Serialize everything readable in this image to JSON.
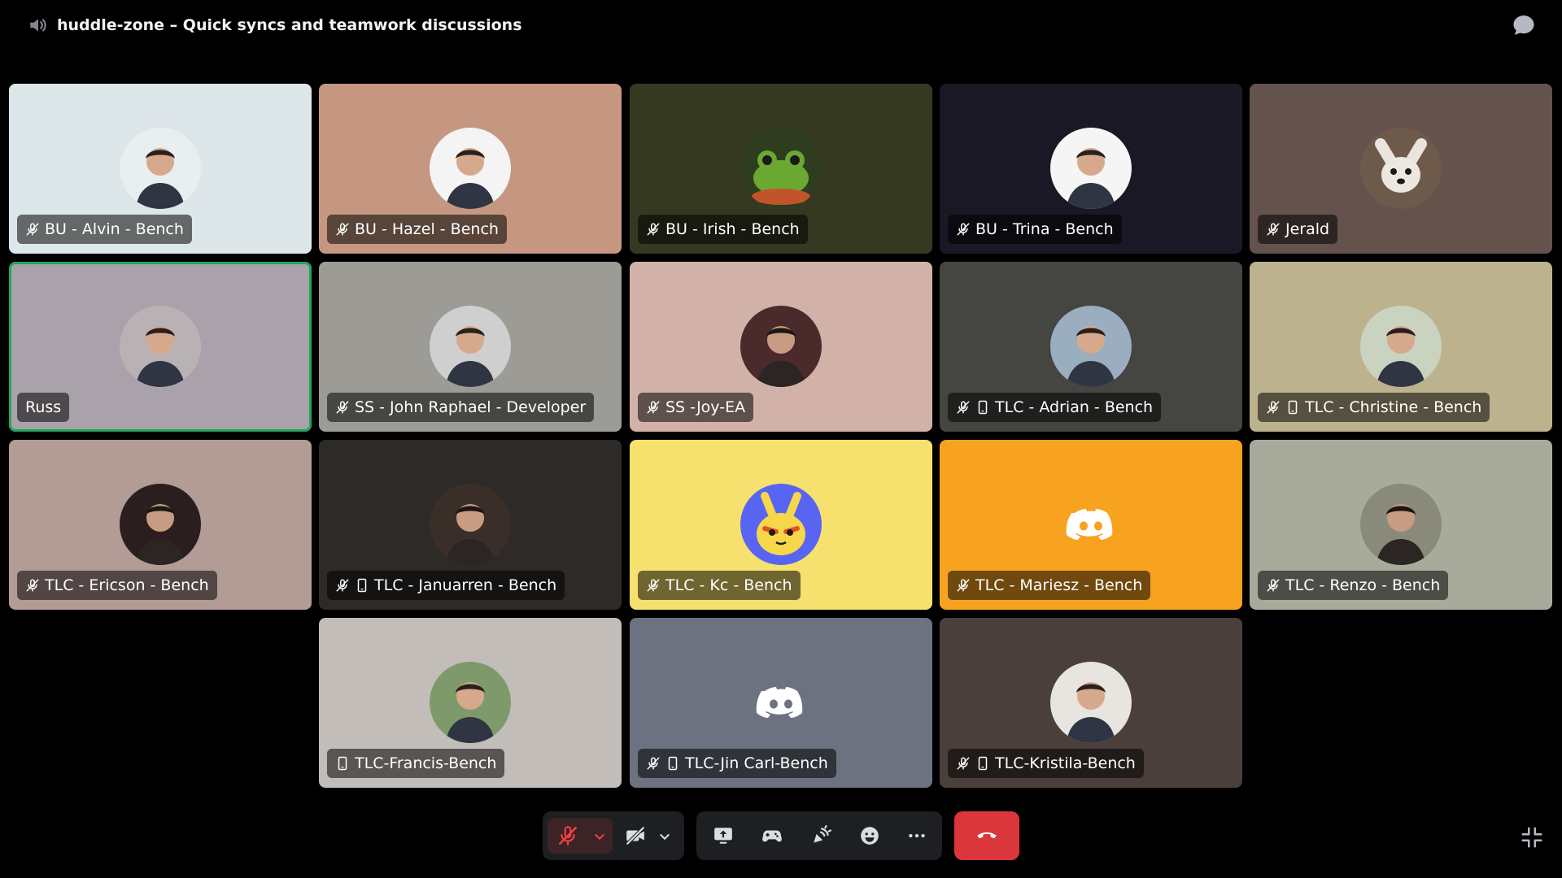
{
  "header": {
    "channel_title": "huddle-zone – Quick syncs and teamwork discussions",
    "speaker_icon": "speaker-icon",
    "chat_icon": "chat-bubble-icon"
  },
  "participants": [
    {
      "name": "BU - Alvin - Bench",
      "muted": true,
      "mobile": false,
      "bg": "#dde6e9",
      "avatar_bg": "#e9eef0",
      "avatar_type": "photo-light",
      "speaking": false
    },
    {
      "name": "BU - Hazel - Bench",
      "muted": true,
      "mobile": false,
      "bg": "#c59780",
      "avatar_bg": "#f4f4f4",
      "avatar_type": "photo-light",
      "speaking": false
    },
    {
      "name": "BU - Irish - Bench",
      "muted": true,
      "mobile": false,
      "bg": "#363922",
      "avatar_bg": "#5f7a3a",
      "avatar_type": "frog",
      "speaking": false
    },
    {
      "name": "BU - Trina - Bench",
      "muted": true,
      "mobile": false,
      "bg": "#1a1824",
      "avatar_bg": "#f5f5f5",
      "avatar_type": "photo-light",
      "speaking": false
    },
    {
      "name": "Jerald",
      "muted": true,
      "mobile": false,
      "bg": "#64524d",
      "avatar_bg": "#6e5a4a",
      "avatar_type": "dog",
      "speaking": false
    },
    {
      "name": "Russ",
      "muted": false,
      "mobile": false,
      "bg": "#aaa2ab",
      "avatar_bg": "#b9b2b5",
      "avatar_type": "photo-light",
      "speaking": true
    },
    {
      "name": "SS - John Raphael - Developer",
      "muted": true,
      "mobile": false,
      "bg": "#9c9b95",
      "avatar_bg": "#cfcfcf",
      "avatar_type": "photo-light",
      "speaking": false
    },
    {
      "name": "SS -Joy-EA",
      "muted": true,
      "mobile": false,
      "bg": "#d2b2a8",
      "avatar_bg": "#4a2a2a",
      "avatar_type": "photo-dark",
      "speaking": false
    },
    {
      "name": "TLC - Adrian - Bench",
      "muted": true,
      "mobile": true,
      "bg": "#454541",
      "avatar_bg": "#9aaec0",
      "avatar_type": "photo-light",
      "speaking": false
    },
    {
      "name": "TLC - Christine - Bench",
      "muted": true,
      "mobile": true,
      "bg": "#bcb28d",
      "avatar_bg": "#c9d3c0",
      "avatar_type": "photo-light",
      "speaking": false
    },
    {
      "name": "TLC - Ericson - Bench",
      "muted": true,
      "mobile": false,
      "bg": "#b39b96",
      "avatar_bg": "#2a1e1e",
      "avatar_type": "photo-dark",
      "speaking": false
    },
    {
      "name": "TLC - Januarren - Bench",
      "muted": true,
      "mobile": true,
      "bg": "#2e2a27",
      "avatar_bg": "#3a2e28",
      "avatar_type": "photo-dark",
      "speaking": false
    },
    {
      "name": "TLC - Kc - Bench",
      "muted": true,
      "mobile": false,
      "bg": "#f6e06e",
      "avatar_bg": "#5865f2",
      "avatar_type": "mascot",
      "speaking": false
    },
    {
      "name": "TLC - Mariesz - Bench",
      "muted": true,
      "mobile": false,
      "bg": "#f8a320",
      "avatar_bg": "#f8a320",
      "avatar_type": "discord",
      "speaking": false
    },
    {
      "name": "TLC - Renzo - Bench",
      "muted": true,
      "mobile": false,
      "bg": "#a8ab9c",
      "avatar_bg": "#8a8a7a",
      "avatar_type": "photo-dark",
      "speaking": false
    },
    {
      "name": "TLC-Francis-Bench",
      "muted": false,
      "mobile": true,
      "bg": "#c3bdb9",
      "avatar_bg": "#7f9a6a",
      "avatar_type": "photo-light",
      "speaking": false
    },
    {
      "name": "TLC-Jin Carl-Bench",
      "muted": true,
      "mobile": true,
      "bg": "#6d7280",
      "avatar_bg": "#6d7280",
      "avatar_type": "discord",
      "speaking": false
    },
    {
      "name": "TLC-Kristila-Bench",
      "muted": true,
      "mobile": true,
      "bg": "#4a3f3b",
      "avatar_bg": "#e8e4e0",
      "avatar_type": "photo-light",
      "speaking": false
    }
  ],
  "controls": {
    "mic_icon": "mic-muted-icon",
    "mic_options_icon": "chevron-down-icon",
    "camera_icon": "camera-off-icon",
    "camera_options_icon": "chevron-down-icon",
    "screen_share_icon": "screen-share-icon",
    "activity_icon": "game-controller-icon",
    "soundboard_icon": "soundboard-icon",
    "emoji_icon": "emoji-icon",
    "more_icon": "more-icon",
    "end_call_icon": "phone-hangup-icon",
    "collapse_icon": "collapse-icon",
    "end_call_color": "#da373c",
    "muted_color": "#f23f43"
  }
}
